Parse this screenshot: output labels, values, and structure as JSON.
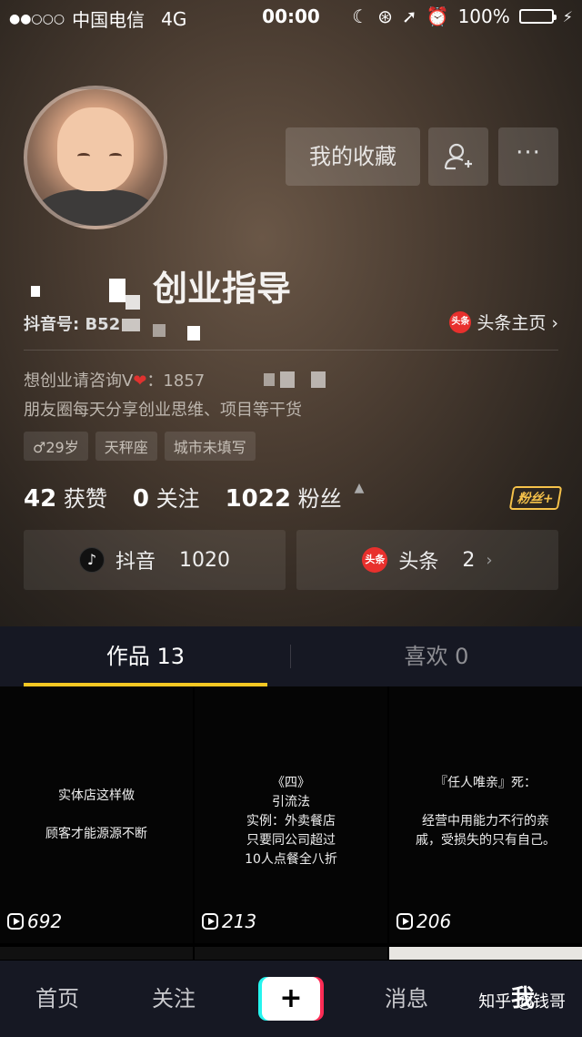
{
  "status_bar": {
    "signal": "●●○○○",
    "carrier": "中国电信",
    "network": "4G",
    "time": "00:00",
    "battery": "100%"
  },
  "profile": {
    "name": "创业指导",
    "douyin_id_label": "抖音号: B52",
    "toutiao_home": "头条主页 ›",
    "bio_line1_a": "想创业请咨询V",
    "bio_line1_b": "：1857",
    "bio_line2": "朋友圈每天分享创业思维、项目等干货",
    "tags": [
      "♂29岁",
      "天秤座",
      "城市未填写"
    ]
  },
  "actions": {
    "collect_label": "我的收藏",
    "more_label": "···"
  },
  "stats": {
    "likes_count": "42",
    "likes_label": "获赞",
    "following_count": "0",
    "following_label": "关注",
    "fans_count": "1022",
    "fans_label": "粉丝",
    "fans_badge": "粉丝+"
  },
  "platforms": {
    "douyin_name": "抖音",
    "douyin_count": "1020",
    "toutiao_name": "头条",
    "toutiao_count": "2",
    "toutiao_logo": "头条"
  },
  "tabs": {
    "works": "作品 13",
    "likes": "喜欢 0"
  },
  "videos": [
    {
      "caption": "实体店这样做\n\n顾客才能源源不断",
      "plays": "692"
    },
    {
      "caption": "《四》\n引流法\n实例：外卖餐店\n只要同公司超过\n10人点餐全八折",
      "plays": "213"
    },
    {
      "caption": "『任人唯亲』死：\n\n经营中用能力不行的亲\n戚，受损失的只有自己。",
      "plays": "206"
    }
  ],
  "bottom_nav": {
    "home": "首页",
    "follow": "关注",
    "plus": "+",
    "messages": "消息",
    "me": "我"
  },
  "watermark": "知乎 @钱哥"
}
